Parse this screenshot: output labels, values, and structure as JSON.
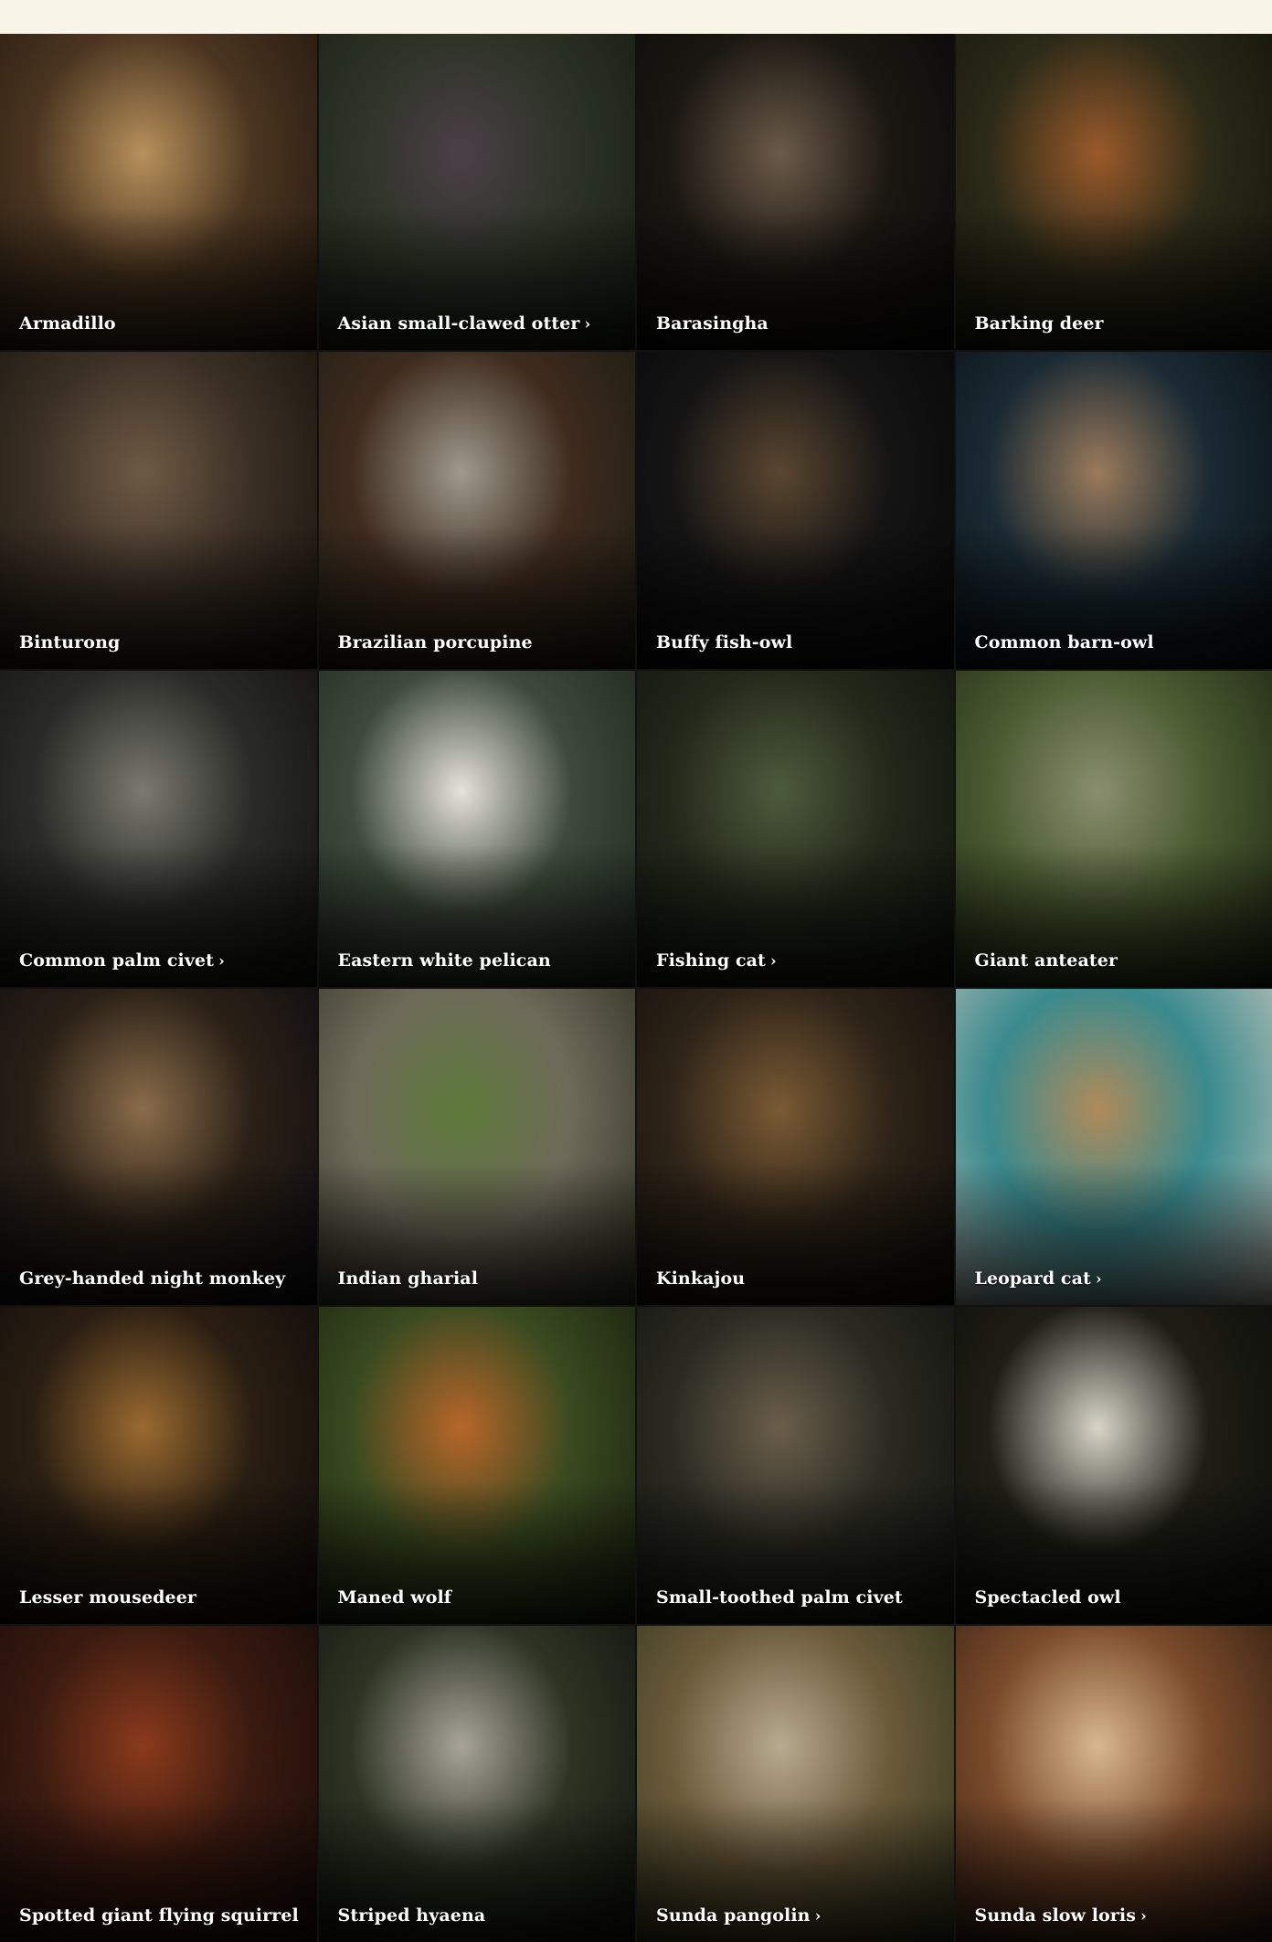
{
  "animals": [
    {
      "name": "Armadillo",
      "has_link": false,
      "colors": [
        "#b8915c",
        "#4a3520",
        "#1d140c"
      ]
    },
    {
      "name": "Asian small-clawed otter",
      "has_link": true,
      "colors": [
        "#4b3f47",
        "#2c3326",
        "#151a12"
      ]
    },
    {
      "name": "Barasingha",
      "has_link": false,
      "colors": [
        "#6b5a48",
        "#1b1712",
        "#070707"
      ]
    },
    {
      "name": "Barking deer",
      "has_link": false,
      "colors": [
        "#9a5a2a",
        "#2c2a18",
        "#0f110a"
      ]
    },
    {
      "name": "Binturong",
      "has_link": false,
      "colors": [
        "#6e5a44",
        "#3a2f25",
        "#141008"
      ]
    },
    {
      "name": "Brazilian porcupine",
      "has_link": false,
      "colors": [
        "#9e9a8c",
        "#3e2b1e",
        "#171a10"
      ]
    },
    {
      "name": "Buffy fish-owl",
      "has_link": false,
      "colors": [
        "#5a4630",
        "#141414",
        "#050505"
      ]
    },
    {
      "name": "Common barn-owl",
      "has_link": false,
      "colors": [
        "#9a7b5c",
        "#1a2a33",
        "#070b10"
      ]
    },
    {
      "name": "Common palm civet",
      "has_link": true,
      "colors": [
        "#7a7a72",
        "#2a2a26",
        "#0f0e0c"
      ]
    },
    {
      "name": "Eastern white pelican",
      "has_link": false,
      "colors": [
        "#e6e2dc",
        "#3e4a3c",
        "#1a221a"
      ]
    },
    {
      "name": "Fishing cat",
      "has_link": true,
      "colors": [
        "#4e5a3c",
        "#22281a",
        "#0c0e0a"
      ]
    },
    {
      "name": "Giant anteater",
      "has_link": false,
      "colors": [
        "#8a8e70",
        "#4a5a30",
        "#1c2212"
      ]
    },
    {
      "name": "Grey-handed night monkey",
      "has_link": false,
      "colors": [
        "#8a6c4a",
        "#2a2016",
        "#0a0a10"
      ]
    },
    {
      "name": "Indian gharial",
      "has_link": false,
      "colors": [
        "#5e7a3a",
        "#6e6a5a",
        "#2a2a1c"
      ]
    },
    {
      "name": "Kinkajou",
      "has_link": false,
      "colors": [
        "#7a5a34",
        "#2e2418",
        "#0c0a08"
      ]
    },
    {
      "name": "Leopard cat",
      "has_link": true,
      "colors": [
        "#b08a5a",
        "#3a8a8e",
        "#c8c6bc"
      ]
    },
    {
      "name": "Lesser mousedeer",
      "has_link": false,
      "colors": [
        "#9a6a30",
        "#2a1e12",
        "#0c0a08"
      ]
    },
    {
      "name": "Maned wolf",
      "has_link": false,
      "colors": [
        "#b8662a",
        "#3a4a20",
        "#161a0c"
      ]
    },
    {
      "name": "Small-toothed palm civet",
      "has_link": false,
      "colors": [
        "#6a5e4a",
        "#2a2a22",
        "#0e0e0c"
      ]
    },
    {
      "name": "Spectacled owl",
      "has_link": false,
      "colors": [
        "#d8d4c8",
        "#1e1e16",
        "#0a0a08"
      ]
    },
    {
      "name": "Spotted giant flying squirrel",
      "has_link": false,
      "colors": [
        "#8a3a1c",
        "#3a1a10",
        "#120a08"
      ]
    },
    {
      "name": "Striped hyaena",
      "has_link": false,
      "colors": [
        "#a8a49a",
        "#2e3424",
        "#0e100a"
      ]
    },
    {
      "name": "Sunda pangolin",
      "has_link": true,
      "colors": [
        "#b8aa90",
        "#6a5a3a",
        "#2a3018"
      ]
    },
    {
      "name": "Sunda slow loris",
      "has_link": true,
      "colors": [
        "#d8b890",
        "#7a4a2a",
        "#2a1a10"
      ]
    }
  ],
  "chevron_glyph": "›"
}
